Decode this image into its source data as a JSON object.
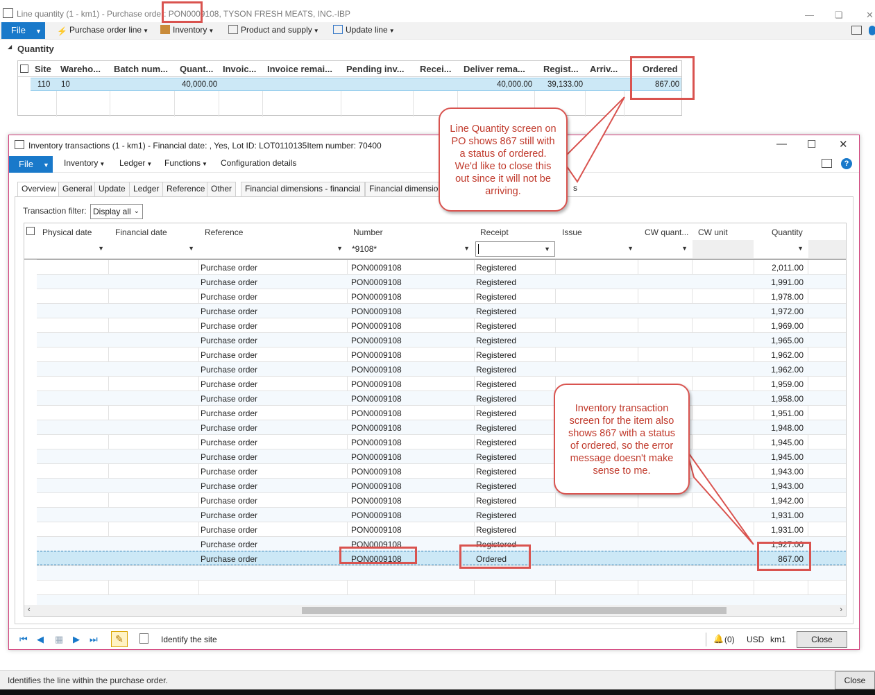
{
  "back_window": {
    "title": "Line quantity (1 - km1) - Purchase order: PON0009108, TYSON FRESH MEATS, INC.-IBP",
    "menu": {
      "file": "File",
      "items": [
        "Purchase order line",
        "Inventory",
        "Product and supply",
        "Update line"
      ]
    },
    "section_label": "Quantity",
    "grid": {
      "headers": [
        "Site",
        "Wareho...",
        "Batch num...",
        "Quant...",
        "Invoic...",
        "Invoice remai...",
        "Pending inv...",
        "Recei...",
        "Deliver rema...",
        "Regist...",
        "Arriv...",
        "Ordered"
      ],
      "row": {
        "site": "110",
        "warehouse": "10",
        "quantity": "40,000.00",
        "deliver_remainder": "40,000.00",
        "registered": "39,133.00",
        "ordered": "867.00"
      }
    },
    "status_text": "Identifies the line within the purchase order.",
    "close_label": "Close"
  },
  "dialog": {
    "title": "Inventory transactions (1 - km1) - Financial date: , Yes, Lot ID: LOT0110135Item number: 70400",
    "menu": {
      "file": "File",
      "items": [
        "Inventory",
        "Ledger",
        "Functions",
        "Configuration details"
      ]
    },
    "tabs": [
      "Overview",
      "General",
      "Update",
      "Ledger",
      "Reference",
      "Other",
      "Financial dimensions - financial",
      "Financial dimension",
      "s"
    ],
    "filter": {
      "label": "Transaction filter:",
      "value": "Display all"
    },
    "columns": [
      "Physical date",
      "Financial date",
      "Reference",
      "Number",
      "Receipt",
      "Issue",
      "CW quant...",
      "CW unit",
      "Quantity"
    ],
    "number_filter": "*9108*",
    "rows": [
      {
        "reference": "Purchase order",
        "number": "PON0009108",
        "receipt": "Registered",
        "quantity": "2,011.00"
      },
      {
        "reference": "Purchase order",
        "number": "PON0009108",
        "receipt": "Registered",
        "quantity": "1,991.00"
      },
      {
        "reference": "Purchase order",
        "number": "PON0009108",
        "receipt": "Registered",
        "quantity": "1,978.00"
      },
      {
        "reference": "Purchase order",
        "number": "PON0009108",
        "receipt": "Registered",
        "quantity": "1,972.00"
      },
      {
        "reference": "Purchase order",
        "number": "PON0009108",
        "receipt": "Registered",
        "quantity": "1,969.00"
      },
      {
        "reference": "Purchase order",
        "number": "PON0009108",
        "receipt": "Registered",
        "quantity": "1,965.00"
      },
      {
        "reference": "Purchase order",
        "number": "PON0009108",
        "receipt": "Registered",
        "quantity": "1,962.00"
      },
      {
        "reference": "Purchase order",
        "number": "PON0009108",
        "receipt": "Registered",
        "quantity": "1,962.00"
      },
      {
        "reference": "Purchase order",
        "number": "PON0009108",
        "receipt": "Registered",
        "quantity": "1,959.00"
      },
      {
        "reference": "Purchase order",
        "number": "PON0009108",
        "receipt": "Registered",
        "quantity": "1,958.00"
      },
      {
        "reference": "Purchase order",
        "number": "PON0009108",
        "receipt": "Registered",
        "quantity": "1,951.00"
      },
      {
        "reference": "Purchase order",
        "number": "PON0009108",
        "receipt": "Registered",
        "quantity": "1,948.00"
      },
      {
        "reference": "Purchase order",
        "number": "PON0009108",
        "receipt": "Registered",
        "quantity": "1,945.00"
      },
      {
        "reference": "Purchase order",
        "number": "PON0009108",
        "receipt": "Registered",
        "quantity": "1,945.00"
      },
      {
        "reference": "Purchase order",
        "number": "PON0009108",
        "receipt": "Registered",
        "quantity": "1,943.00"
      },
      {
        "reference": "Purchase order",
        "number": "PON0009108",
        "receipt": "Registered",
        "quantity": "1,943.00"
      },
      {
        "reference": "Purchase order",
        "number": "PON0009108",
        "receipt": "Registered",
        "quantity": "1,942.00"
      },
      {
        "reference": "Purchase order",
        "number": "PON0009108",
        "receipt": "Registered",
        "quantity": "1,931.00"
      },
      {
        "reference": "Purchase order",
        "number": "PON0009108",
        "receipt": "Registered",
        "quantity": "1,931.00"
      },
      {
        "reference": "Purchase order",
        "number": "PON0009108",
        "receipt": "Registered",
        "quantity": "1,927.00"
      },
      {
        "reference": "Purchase order",
        "number": "PON0009108",
        "receipt": "Ordered",
        "quantity": "867.00"
      }
    ],
    "status": {
      "text": "Identify the site",
      "alerts": "(0)",
      "currency": "USD",
      "company": "km1",
      "close": "Close"
    }
  },
  "callouts": {
    "line_quantity": "Line Quantity screen on PO shows 867 still with a status of ordered. We'd like to close this out since it will not be arriving.",
    "inventory": "Inventory transaction screen for the item also shows 867 with a status of ordered, so the error message doesn't make sense to me."
  },
  "colors": {
    "accent": "#1979ca",
    "selected_row": "#cce8f6",
    "annotation_red": "#d9534f"
  }
}
